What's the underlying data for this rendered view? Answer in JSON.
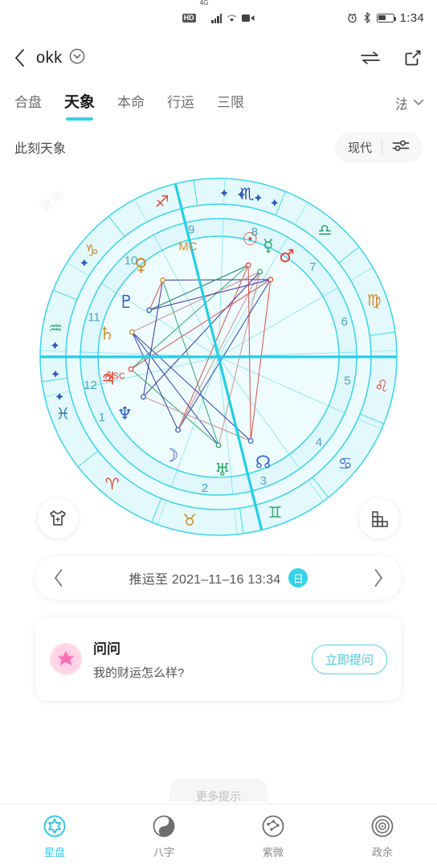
{
  "statusbar": {
    "hd_label": "HD",
    "network_label": "4G",
    "icons": [
      "hd-icon",
      "signal-icon",
      "wifi-icon",
      "video-record-icon",
      "alarm-icon",
      "bluetooth-icon",
      "battery-icon"
    ],
    "time": "1:34"
  },
  "header": {
    "back_label": "‹",
    "title": "okk",
    "dropdown_icon": "chevron-down-circle-icon",
    "swap_icon": "swap-arrows-icon",
    "share_icon": "share-external-icon"
  },
  "tabs": {
    "items": [
      {
        "label": "合盘",
        "active": false
      },
      {
        "label": "天象",
        "active": true
      },
      {
        "label": "本命",
        "active": false
      },
      {
        "label": "行运",
        "active": false
      },
      {
        "label": "三限",
        "active": false
      }
    ],
    "overflow_partial": "法",
    "overflow_icon": "chevron-down-icon",
    "active_underline_color": "#35d2ea"
  },
  "subheader": {
    "title": "此刻天象",
    "mode_label": "现代",
    "settings_icon": "sliders-filter-icon"
  },
  "chart_data": {
    "type": "astrology-wheel",
    "title": "此刻天象",
    "watermark": "测测",
    "ring_stroke": "#35d6ea",
    "ring_fill_outer": "#e4f9fc",
    "ring_fill_inner": "#ecfbfd",
    "axis_color": "#22cfe6",
    "house_number_color": "#4aa8bd",
    "signs": [
      {
        "glyph": "♑",
        "name": "Capricorn",
        "color": "#c8922f",
        "angle": 132
      },
      {
        "glyph": "♐",
        "name": "Sagittarius",
        "color": "#e04a3a",
        "angle": 102
      },
      {
        "glyph": "♏",
        "name": "Scorpio",
        "color": "#2f4bb5",
        "angle": 72
      },
      {
        "glyph": "♎",
        "name": "Libra",
        "color": "#24a06a",
        "angle": 42
      },
      {
        "glyph": "♍",
        "name": "Virgo",
        "color": "#d08a2a",
        "angle": 12
      },
      {
        "glyph": "♌",
        "name": "Leo",
        "color": "#e0503f",
        "angle": -18
      },
      {
        "glyph": "♋",
        "name": "Cancer",
        "color": "#3b6fd4",
        "angle": -48
      },
      {
        "glyph": "♊",
        "name": "Gemini",
        "color": "#36a86c",
        "angle": -78
      },
      {
        "glyph": "♉",
        "name": "Taurus",
        "color": "#d08a2a",
        "angle": -108
      },
      {
        "glyph": "♈",
        "name": "Aries",
        "color": "#e04a3a",
        "angle": -138
      },
      {
        "glyph": "♓",
        "name": "Pisces",
        "color": "#2b7fb5",
        "angle": -168
      },
      {
        "glyph": "♒",
        "name": "Aquarius",
        "color": "#2fa86e",
        "angle": 162
      }
    ],
    "houses": [
      {
        "number": "1",
        "angle": -175
      },
      {
        "number": "2",
        "angle": -118
      },
      {
        "number": "3",
        "angle": -92
      },
      {
        "number": "4",
        "angle": -62
      },
      {
        "number": "5",
        "angle": -32
      },
      {
        "number": "6",
        "angle": -6
      },
      {
        "number": "7",
        "angle": 22
      },
      {
        "number": "8",
        "angle": 52
      },
      {
        "number": "9",
        "angle": 80
      },
      {
        "number": "10",
        "angle": 110
      },
      {
        "number": "11",
        "angle": 140
      },
      {
        "number": "12",
        "angle": 170
      }
    ],
    "axes": [
      {
        "label": "MC",
        "color": "#c8922f"
      },
      {
        "label": "Asc",
        "color": "#e05a46"
      }
    ],
    "planets": [
      {
        "glyph": "☉",
        "name": "Sun",
        "color": "#e0453a",
        "angle": 67,
        "r": 152,
        "point_angle": 64,
        "point_r": 120
      },
      {
        "glyph": "☿",
        "name": "Mercury",
        "color": "#2fa86e",
        "angle": 58,
        "r": 152,
        "point_angle": 56,
        "point_r": 118
      },
      {
        "glyph": "♂",
        "name": "Mars",
        "color": "#e0453a",
        "angle": 48,
        "r": 152,
        "point_angle": 48,
        "point_r": 116
      },
      {
        "glyph": "♀",
        "name": "Venus",
        "color": "#d08a2a",
        "angle": 122,
        "r": 150,
        "point_angle": 118,
        "point_r": 118
      },
      {
        "glyph": "♄",
        "name": "Saturn",
        "color": "#c8922f",
        "angle": 160,
        "r": 142,
        "point_angle": 156,
        "point_r": 112
      },
      {
        "glyph": "♃",
        "name": "Jupiter",
        "color": "#e0453a",
        "angle": 183,
        "r": 140,
        "point_angle": 180,
        "point_r": 110
      },
      {
        "glyph": "♇",
        "name": "Pluto",
        "color": "#2f5bc4",
        "angle": 141,
        "r": 134,
        "point_angle": 138,
        "point_r": 104
      },
      {
        "glyph": "♆",
        "name": "Neptune",
        "color": "#2f5bc4",
        "angle": 203,
        "r": 136,
        "point_angle": 200,
        "point_r": 106
      },
      {
        "glyph": "☽",
        "name": "Moon",
        "color": "#2f5bc4",
        "angle": 236,
        "r": 136,
        "point_angle": 233,
        "point_r": 104
      },
      {
        "glyph": "♅",
        "name": "Uranus",
        "color": "#2fa86e",
        "angle": 264,
        "r": 140,
        "point_angle": 262,
        "point_r": 110
      },
      {
        "glyph": "☊",
        "name": "North Node",
        "color": "#3b6fd4",
        "angle": 285,
        "r": 142,
        "point_angle": 283,
        "point_r": 112
      }
    ],
    "aspect_colors": [
      "#2f3fb5",
      "#d94b45",
      "#2fa86e",
      "#3f2fa0",
      "#c98f8f"
    ],
    "star_markers": 7
  },
  "fabs": {
    "left_icon": "tshirt-icon",
    "right_icon": "aspect-grid-icon"
  },
  "datebar": {
    "prev_icon": "chevron-left-icon",
    "next_icon": "chevron-right-icon",
    "label": "推运至 2021–11–16 13:34",
    "badge": "日",
    "badge_color": "#35d2ea"
  },
  "ask_card": {
    "avatar_icon": "pink-star-avatar",
    "title": "问问",
    "question": "我的财运怎么样?",
    "button_label": "立即提问"
  },
  "peek_pill": {
    "text": "更多提示"
  },
  "bottomnav": {
    "items": [
      {
        "label": "星盘",
        "icon": "star-chart-icon",
        "active": true
      },
      {
        "label": "八字",
        "icon": "yin-yang-icon",
        "active": false
      },
      {
        "label": "紫微",
        "icon": "constellation-icon",
        "active": false
      },
      {
        "label": "政余",
        "icon": "concentric-circles-icon",
        "active": false
      }
    ],
    "active_color": "#35c8e8"
  }
}
